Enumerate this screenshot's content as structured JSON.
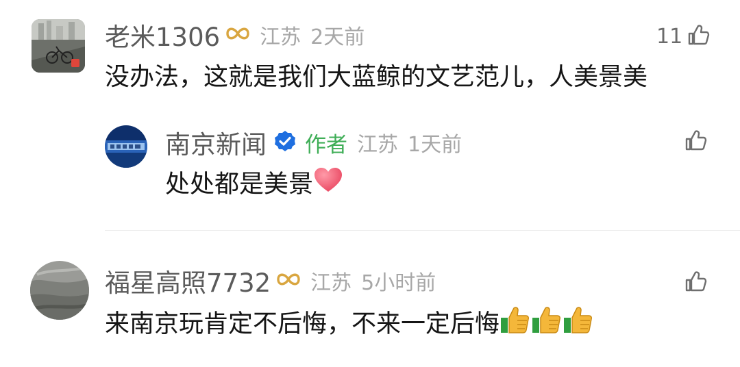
{
  "comments": [
    {
      "username": "老米1306",
      "location": "江苏",
      "time": "2天前",
      "text": "没办法，这就是我们大蓝鲸的文艺范儿，人美景美",
      "like_count": "11"
    },
    {
      "username": "南京新闻",
      "author_label": "作者",
      "location": "江苏",
      "time": "1天前",
      "text": "处处都是美景"
    },
    {
      "username": "福星高照7732",
      "location": "江苏",
      "time": "5小时前",
      "text": "来南京玩肯定不后悔，不来一定后悔"
    }
  ],
  "icons": {
    "badge": "infinity-badge-icon",
    "verified": "verified-check-icon",
    "like": "thumbs-up-icon",
    "heart": "heart-emoji",
    "thumbs": "thumbs-up-emoji"
  },
  "colors": {
    "username": "#5b5b5b",
    "meta": "#a7a7a7",
    "author_tag": "#3fae57",
    "text": "#151515",
    "verified": "#1f6fe0",
    "heart": "#f0566f"
  }
}
